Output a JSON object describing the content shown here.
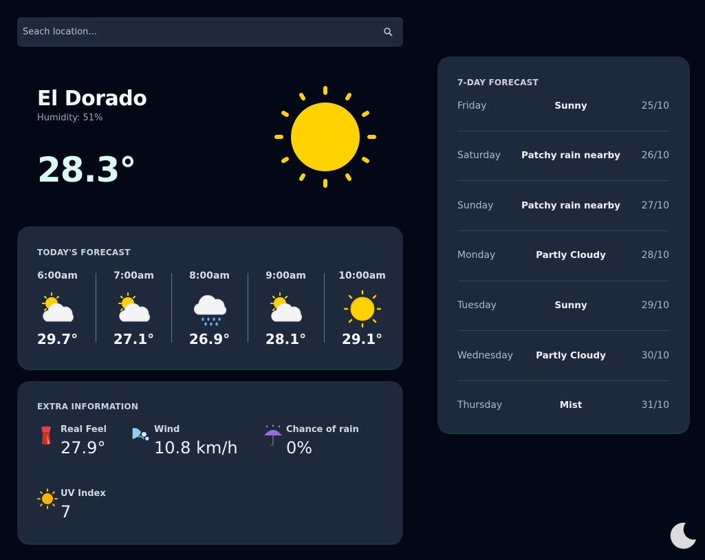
{
  "search": {
    "placeholder": "Seach location..."
  },
  "current": {
    "city": "El Dorado",
    "humidity": "Humidity: 51%",
    "temperature": "28.3°",
    "icon": "sun-icon"
  },
  "today": {
    "title": "TODAY'S FORECAST",
    "hours": [
      {
        "time": "6:00am",
        "temp": "29.7°",
        "icon": "partly-cloudy-icon"
      },
      {
        "time": "7:00am",
        "temp": "27.1°",
        "icon": "partly-cloudy-icon"
      },
      {
        "time": "8:00am",
        "temp": "26.9°",
        "icon": "rain-cloud-icon"
      },
      {
        "time": "9:00am",
        "temp": "28.1°",
        "icon": "partly-cloudy-icon"
      },
      {
        "time": "10:00am",
        "temp": "29.1°",
        "icon": "sun-icon"
      }
    ]
  },
  "extra": {
    "title": "EXTRA INFORMATION",
    "items": [
      {
        "label": "Real Feel",
        "value": "27.9°",
        "icon": "thermometer-scarf-icon"
      },
      {
        "label": "Wind",
        "value": "10.8 km/h",
        "icon": "wind-icon"
      },
      {
        "label": "Chance of rain",
        "value": "0%",
        "icon": "umbrella-rain-icon"
      },
      {
        "label": "UV Index",
        "value": "7",
        "icon": "sun-icon"
      }
    ]
  },
  "week": {
    "title": "7-DAY FORECAST",
    "days": [
      {
        "day": "Friday",
        "condition": "Sunny",
        "date": "25/10"
      },
      {
        "day": "Saturday",
        "condition": "Patchy rain nearby",
        "date": "26/10"
      },
      {
        "day": "Sunday",
        "condition": "Patchy rain nearby",
        "date": "27/10"
      },
      {
        "day": "Monday",
        "condition": "Partly Cloudy",
        "date": "28/10"
      },
      {
        "day": "Tuesday",
        "condition": "Sunny",
        "date": "29/10"
      },
      {
        "day": "Wednesday",
        "condition": "Partly Cloudy",
        "date": "30/10"
      },
      {
        "day": "Thursday",
        "condition": "Mist",
        "date": "31/10"
      }
    ]
  },
  "theme_toggle": {
    "icon": "moon-icon"
  },
  "colors": {
    "background": "#030817",
    "card": "#1e293b",
    "sun": "#ffd200",
    "temp_accent": "#d9fbf5"
  }
}
